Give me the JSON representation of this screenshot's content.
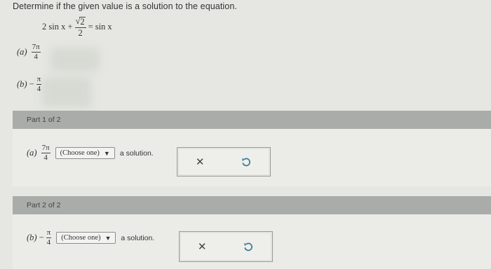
{
  "question": {
    "text": "Determine if the given value is a solution to the equation."
  },
  "equation": {
    "lhs_prefix": "2 sin x +",
    "frac_num": "2",
    "frac_den": "2",
    "equals": "=",
    "rhs": "sin x"
  },
  "options": [
    {
      "label": "(a)",
      "sign": "",
      "num": "7π",
      "den": "4"
    },
    {
      "label": "(b)",
      "sign": "−",
      "num": "π",
      "den": "4"
    }
  ],
  "parts": [
    {
      "label": "Part 1 of 2",
      "answer_label": "(a)",
      "sign": "",
      "num": "7π",
      "den": "4",
      "select": "(Choose one)",
      "suffix": "a solution."
    },
    {
      "label": "Part 2 of 2",
      "answer_label": "(b)",
      "sign": "−",
      "num": "π",
      "den": "4",
      "select": "(Choose one)",
      "suffix": "a solution."
    }
  ],
  "icons": {
    "clear": "close-icon",
    "undo": "undo-icon",
    "dropdown": "caret-down-icon"
  },
  "colors": {
    "background": "#e6e7e2",
    "part_band": "#a9aca9",
    "undo_icon": "#3f7f98"
  }
}
